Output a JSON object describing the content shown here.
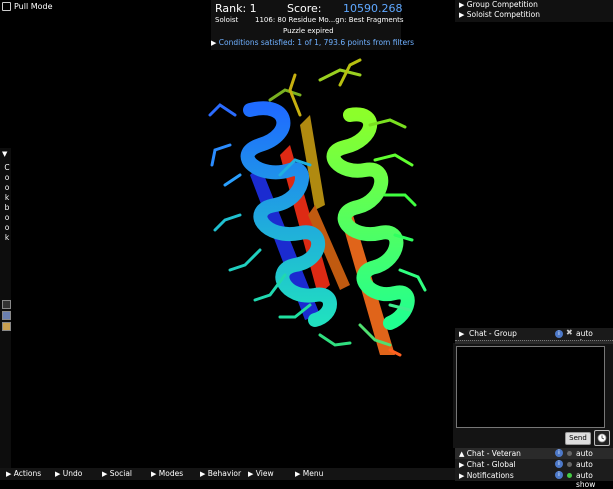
{
  "pull_mode": {
    "label": "Pull Mode"
  },
  "score_panel": {
    "rank": "Rank: 1",
    "score_label": "Score:",
    "score_value": "10590.268",
    "mode": "Soloist",
    "puzzle": "1106: 80 Residue Mo...gn: Best Fragments",
    "status": "Puzzle expired",
    "conditions": "Conditions satisfied: 1 of 1, 793.6 points from filters"
  },
  "competitions": [
    "Group Competition",
    "Soloist Competition"
  ],
  "cookbook": {
    "letters": [
      "C",
      "o",
      "o",
      "k",
      "b",
      "o",
      "o",
      "k"
    ]
  },
  "chat": {
    "group": {
      "label": "Chat - Group",
      "auto": "auto show",
      "info_icon": "info-icon",
      "close_icon": "close-icon"
    },
    "send": "Send",
    "rows": [
      {
        "label": "Chat - Veteran",
        "auto": "auto show",
        "dot": "#666666"
      },
      {
        "label": "Chat - Global",
        "auto": "auto show",
        "dot": "#666666"
      },
      {
        "label": "Notifications",
        "auto": "auto show",
        "dot": "#44cc44"
      }
    ]
  },
  "bottom_menu": [
    "Actions",
    "Undo",
    "Social",
    "Modes",
    "Behavior",
    "View",
    "Menu"
  ],
  "colors": {
    "score": "#5fa8ff",
    "conditions": "#6fb0ff"
  }
}
